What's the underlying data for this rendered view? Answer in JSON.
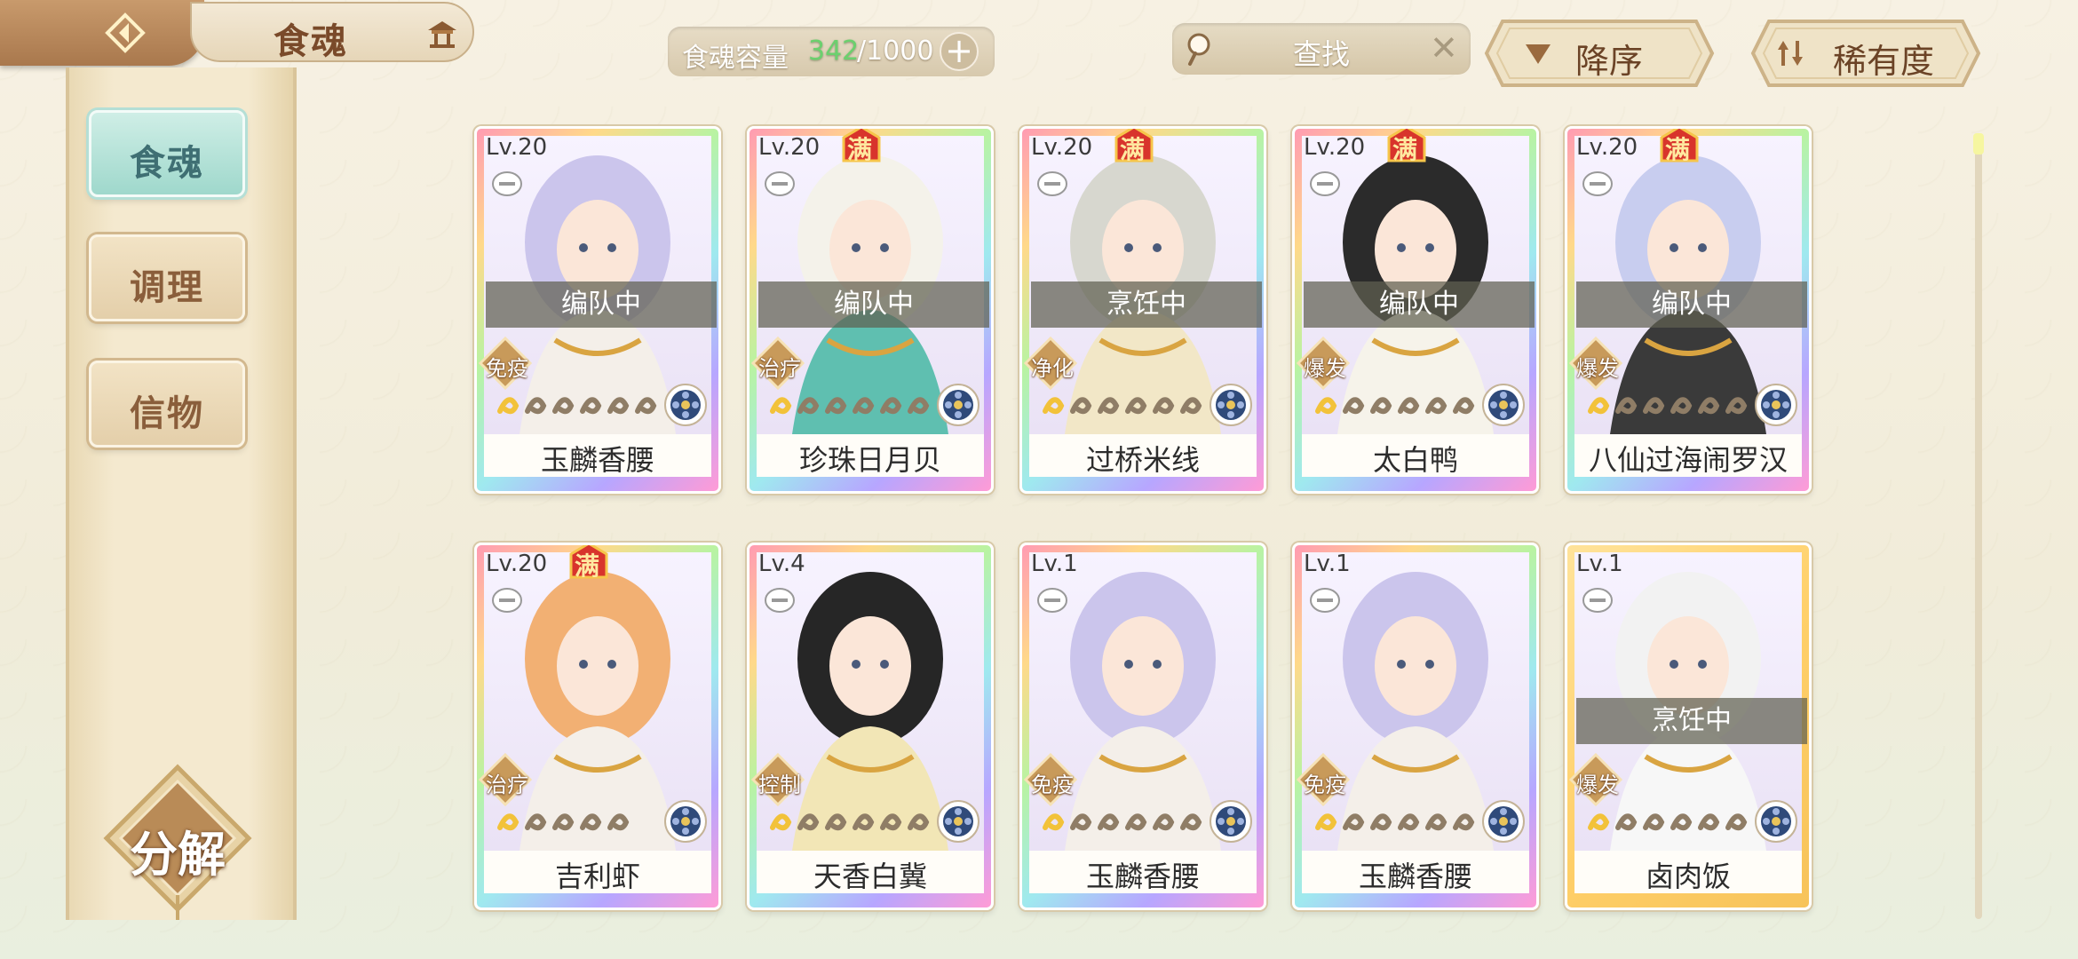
{
  "header": {
    "title": "食魂",
    "capacity": {
      "label": "食魂容量",
      "current": "342",
      "max": "/1000"
    },
    "search": {
      "placeholder": "查找"
    },
    "sort_button": {
      "label": "降序"
    },
    "filter_button": {
      "label": "稀有度"
    }
  },
  "sidebar": {
    "items": [
      {
        "label": "食魂",
        "active": true
      },
      {
        "label": "调理",
        "active": false
      },
      {
        "label": "信物",
        "active": false
      }
    ],
    "decompose_label": "分解"
  },
  "colors": {
    "accent_green": "#6cd06e",
    "active_tab": "#9fd8cc",
    "status_bar": "#5f5f50"
  },
  "cards": [
    {
      "level": "Lv.20",
      "full": true,
      "full_label": "",
      "status": "编队中",
      "role": "免疫",
      "stars": 6,
      "name": "玉麟香腰",
      "hair": "#cbc5ec",
      "outfit": "#f4efe9"
    },
    {
      "level": "Lv.20",
      "full": true,
      "full_label": "满",
      "status": "编队中",
      "role": "治疗",
      "stars": 6,
      "name": "珍珠日月贝",
      "hair": "#f4f2ea",
      "outfit": "#5fbfb0"
    },
    {
      "level": "Lv.20",
      "full": true,
      "full_label": "满",
      "status": "烹饪中",
      "role": "净化",
      "stars": 6,
      "name": "过桥米线",
      "hair": "#d7d7cf",
      "outfit": "#f2e7c7"
    },
    {
      "level": "Lv.20",
      "full": true,
      "full_label": "满",
      "status": "编队中",
      "role": "爆发",
      "stars": 6,
      "name": "太白鸭",
      "hair": "#2b2b2b",
      "outfit": "#f6f3ea"
    },
    {
      "level": "Lv.20",
      "full": true,
      "full_label": "满",
      "status": "编队中",
      "role": "爆发",
      "stars": 6,
      "name": "八仙过海闹罗汉",
      "hair": "#c8cdef",
      "outfit": "#3a3a3a"
    },
    {
      "level": "Lv.20",
      "full": true,
      "full_label": "满",
      "status": "",
      "role": "治疗",
      "stars": 5,
      "name": "吉利虾",
      "hair": "#f2b073",
      "outfit": "#f4efe9"
    },
    {
      "level": "Lv.4",
      "full": false,
      "full_label": "",
      "status": "",
      "role": "控制",
      "stars": 6,
      "name": "天香白冀",
      "hair": "#262626",
      "outfit": "#f2e6b6"
    },
    {
      "level": "Lv.1",
      "full": false,
      "full_label": "",
      "status": "",
      "role": "免疫",
      "stars": 6,
      "name": "玉麟香腰",
      "hair": "#cbc5ec",
      "outfit": "#f4efe9"
    },
    {
      "level": "Lv.1",
      "full": false,
      "full_label": "",
      "status": "",
      "role": "免疫",
      "stars": 6,
      "name": "玉麟香腰",
      "hair": "#cbc5ec",
      "outfit": "#f4efe9"
    },
    {
      "level": "Lv.1",
      "full": false,
      "full_label": "",
      "status": "烹饪中",
      "role": "爆发",
      "stars": 6,
      "name": "卤肉饭",
      "hair": "#f2f2f2",
      "outfit": "#f7f7f7"
    }
  ]
}
